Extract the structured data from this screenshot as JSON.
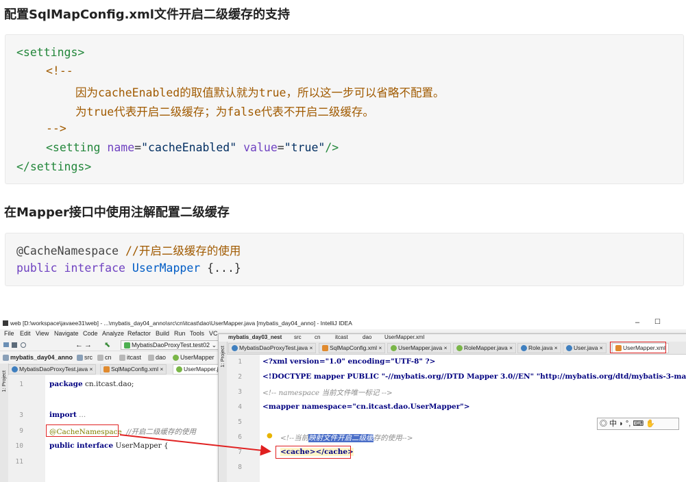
{
  "section1": {
    "heading": "配置SqlMapConfig.xml文件开启二级缓存的支持",
    "code": {
      "l1": "<settings>",
      "l2": "<!--",
      "l3": "因为cacheEnabled的取值默认就为true，所以这一步可以省略不配置。",
      "l4": "为true代表开启二级缓存；为false代表不开启二级缓存。",
      "l5": "-->",
      "l6_open": "<setting ",
      "l6_name_attr": "name",
      "l6_eq1": "=",
      "l6_name_val": "\"cacheEnabled\"",
      "l6_value_attr": " value",
      "l6_eq2": "=",
      "l6_value_val": "\"true\"",
      "l6_close": "/>",
      "l7": "</settings>"
    }
  },
  "section2": {
    "heading": "在Mapper接口中使用注解配置二级缓存",
    "code": {
      "l1_ann": "@CacheNamespace",
      "l1_cmt": " //开启二级缓存的使用",
      "l2_kw1": "public",
      "l2_kw2": "interface",
      "l2_cls": "UserMapper",
      "l2_rest": " {...}"
    }
  },
  "ide": {
    "window_title": "web [D:\\workspace\\javaee31\\web] - ...\\mybatis_day04_anno\\src\\cn\\itcast\\dao\\UserMapper.java [mybatis_day04_anno] - IntelliJ IDEA",
    "window_controls": {
      "minimize": "–",
      "maximize": "☐"
    },
    "menu": [
      "File",
      "Edit",
      "View",
      "Navigate",
      "Code",
      "Analyze",
      "Refactor",
      "Build",
      "Run",
      "Tools",
      "VC"
    ],
    "run_config": "MybatisDaoProxyTest.test02",
    "left_path": [
      "mybatis_day04_anno",
      "src",
      "cn",
      "itcast",
      "dao",
      "UserMapper"
    ],
    "left_tabs": [
      "MybatisDaoProxyTest.java",
      "SqlMapConfig.xml",
      "UserMapper.j"
    ],
    "side_label": "1: Project",
    "left_lines": [
      {
        "num": "1",
        "text": "package cn.itcast.dao;"
      },
      {
        "num": "3",
        "text": "import ..."
      },
      {
        "num": "9",
        "ann": "@CacheNamespace",
        "cmt": "//开启二级缓存的使用"
      },
      {
        "num": "10",
        "kw1": "public",
        "kw2": "interface",
        "cls": "UserMapper {"
      },
      {
        "num": "11",
        "text": ""
      }
    ],
    "right_path": [
      "mybatis_day03_nest",
      "src",
      "cn",
      "itcast",
      "dao",
      "UserMapper.xml"
    ],
    "right_tabs": [
      "MybatisDaoProxyTest.java",
      "SqlMapConfig.xml",
      "UserMapper.java",
      "RoleMapper.java",
      "Role.java",
      "User.java",
      "UserMapper.xml"
    ],
    "right_lines": [
      {
        "num": "1",
        "text": "<?xml version=\"1.0\" encoding=\"UTF-8\" ?>"
      },
      {
        "num": "2",
        "text": "<!DOCTYPE mapper PUBLIC \"-//mybatis.org//DTD Mapper 3.0//EN\" \"http://mybatis.org/dtd/mybatis-3-ma"
      },
      {
        "num": "3",
        "text": "<!-- namespace 当前文件唯一标记 -->"
      },
      {
        "num": "4",
        "text": "<mapper namespace=\"cn.itcast.dao.UserMapper\">"
      },
      {
        "num": "5",
        "text": ""
      },
      {
        "num": "6",
        "cmt_a": "<!--当前",
        "cmt_sel": "映射文件开启二级缓",
        "cmt_b": "存的使用-->"
      },
      {
        "num": "7",
        "text": "<cache></cache>"
      },
      {
        "num": "8",
        "text": ""
      }
    ],
    "ime_toolbar": "中 ◗ °, ⌨ ✋",
    "colors": {
      "red_highlight": "#e02020",
      "selection": "#4a6ec8"
    }
  }
}
